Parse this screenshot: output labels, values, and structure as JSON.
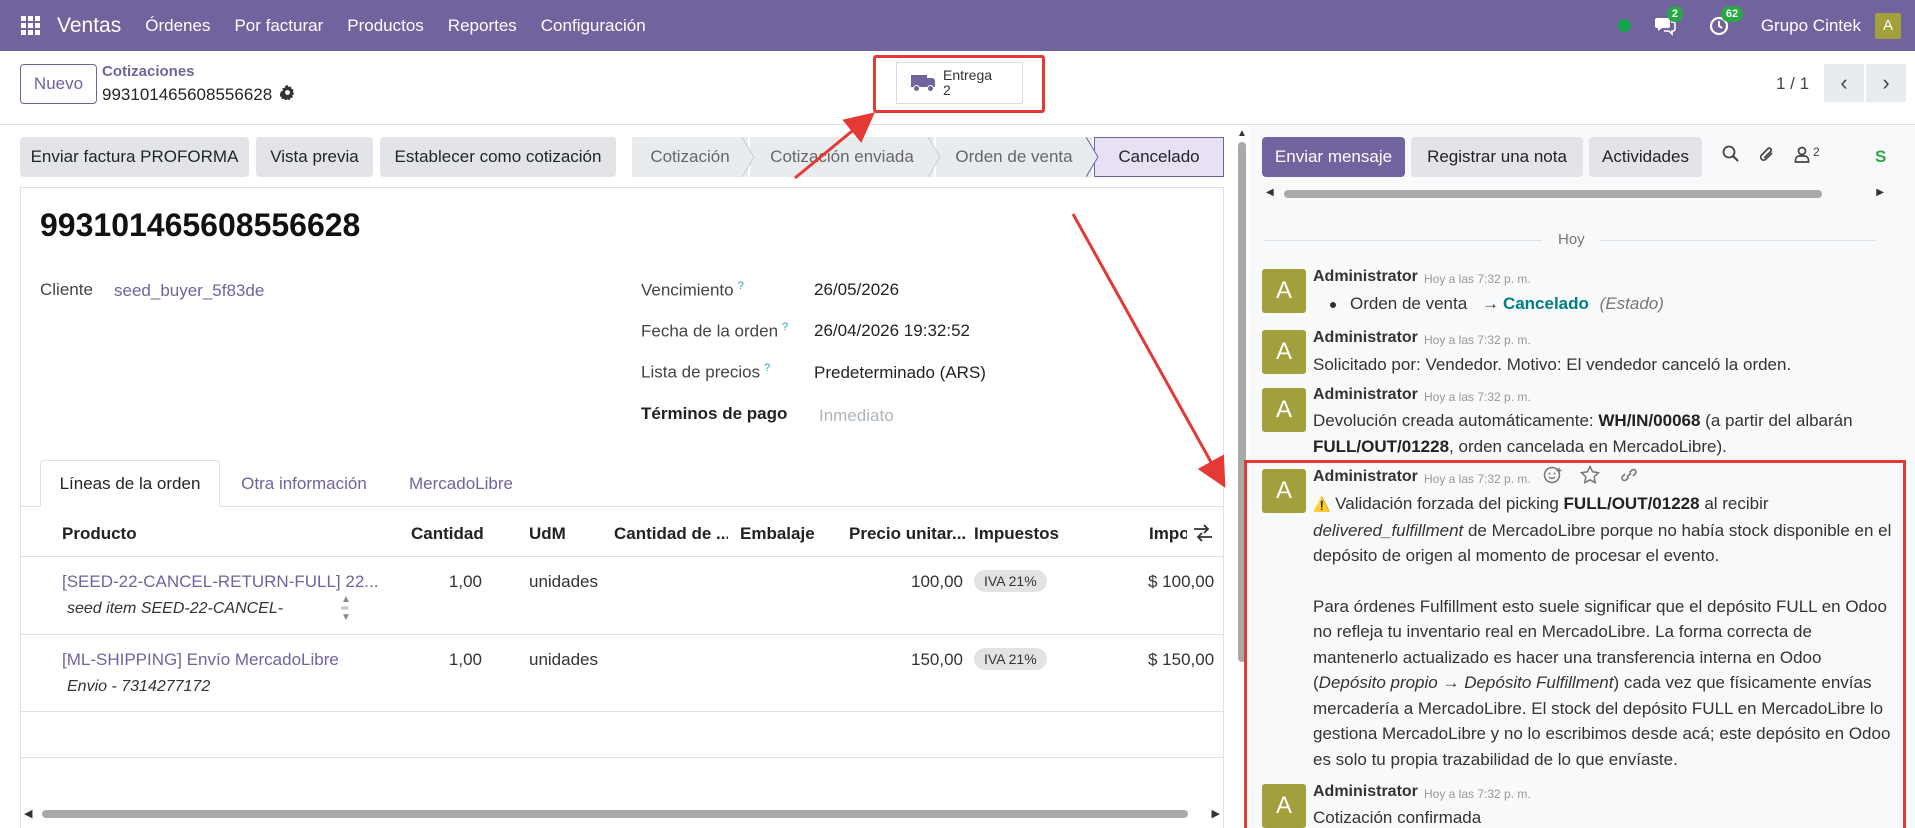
{
  "navbar": {
    "app_name": "Ventas",
    "menu": [
      "Órdenes",
      "Por facturar",
      "Productos",
      "Reportes",
      "Configuración"
    ],
    "messages_count": "2",
    "activities_count": "62",
    "company": "Grupo Cintek",
    "user_initial": "A"
  },
  "control_panel": {
    "new_label": "Nuevo",
    "breadcrumb": "Cotizaciones",
    "record_name": "993101465608556628",
    "smart_button": {
      "label": "Entrega",
      "count": "2"
    },
    "pager": "1 / 1"
  },
  "statusbar": {
    "buttons": [
      "Enviar factura PROFORMA",
      "Vista previa",
      "Establecer como cotización"
    ],
    "stages": [
      "Cotización",
      "Cotización enviada",
      "Orden de venta",
      "Cancelado"
    ],
    "active_stage": "Cancelado"
  },
  "form": {
    "title": "993101465608556628",
    "customer_label": "Cliente",
    "customer": "seed_buyer_5f83de",
    "expiration_label": "Vencimiento",
    "expiration": "26/05/2026",
    "order_date_label": "Fecha de la orden",
    "order_date": "26/04/2026 19:32:52",
    "pricelist_label": "Lista de precios",
    "pricelist": "Predeterminado (ARS)",
    "payment_terms_label": "Términos de pago",
    "payment_terms_placeholder": "Inmediato",
    "tooltip_marker": "?"
  },
  "tabs": [
    "Líneas de la orden",
    "Otra información",
    "MercadoLibre"
  ],
  "order_lines": {
    "columns": [
      "Producto",
      "Cantidad",
      "UdM",
      "Cantidad de ...",
      "Embalaje",
      "Precio unitar...",
      "Impuestos",
      "Impo"
    ],
    "rows": [
      {
        "product": "[SEED-22-CANCEL-RETURN-FULL] 22...",
        "description": "seed item SEED-22-CANCEL-",
        "qty": "1,00",
        "uom": "unidades",
        "price": "100,00",
        "tax": "IVA 21%",
        "subtotal": "$ 100,00"
      },
      {
        "product": "[ML-SHIPPING] Envío MercadoLibre",
        "description": "Envio - 7314277172",
        "qty": "1,00",
        "uom": "unidades",
        "price": "150,00",
        "tax": "IVA 21%",
        "subtotal": "$ 150,00"
      }
    ]
  },
  "chatter": {
    "send_message": "Enviar mensaje",
    "log_note": "Registrar una nota",
    "activities": "Actividades",
    "followers_count": "2",
    "s_label": "S",
    "today": "Hoy",
    "messages": [
      {
        "author": "Administrator",
        "date": "Hoy a las 7:32 p. m.",
        "tracking_field": "Orden de venta",
        "arrow": "→",
        "tracking_value": "Cancelado",
        "tracking_label": "(Estado)"
      },
      {
        "author": "Administrator",
        "date": "Hoy a las 7:32 p. m.",
        "text": "Solicitado por: Vendedor. Motivo: El vendedor canceló la orden."
      },
      {
        "author": "Administrator",
        "date": "Hoy a las 7:32 p. m.",
        "p1": "Devolución creada automáticamente: ",
        "b1": "WH/IN/00068",
        "p2": " (a partir del albarán ",
        "b2": "FULL/OUT/01228",
        "p3": ", orden cancelada en MercadoLibre)."
      },
      {
        "author": "Administrator",
        "date": "Hoy a las 7:32 p. m.",
        "warn": "⚠️",
        "a1": " Validación forzada del picking ",
        "b1": "FULL/OUT/01228",
        "a2": " al recibir ",
        "i1": "delivered_fulfillment",
        "a3": " de MercadoLibre porque no había stock disponible en el depósito de origen al momento de procesar el evento.",
        "c1": "Para órdenes Fulfillment esto suele significar que el depósito FULL en Odoo no refleja tu inventario real en MercadoLibre. La forma correcta de mantenerlo actualizado es hacer una transferencia interna en Odoo (",
        "i2": "Depósito propio → Depósito Fulfillment",
        "c2": ") cada vez que físicamente envías mercadería a MercadoLibre. El stock del depósito FULL en MercadoLibre lo gestiona MercadoLibre y no lo escribimos desde acá; este depósito en Odoo es solo tu propia trazabilidad de lo que envíaste."
      },
      {
        "author": "Administrator",
        "date": "Hoy a las 7:32 p. m.",
        "text": "Cotización confirmada"
      }
    ]
  },
  "colors": {
    "brand": "#71639e",
    "annotation": "#e53935",
    "avatar": "#a2a03c"
  }
}
